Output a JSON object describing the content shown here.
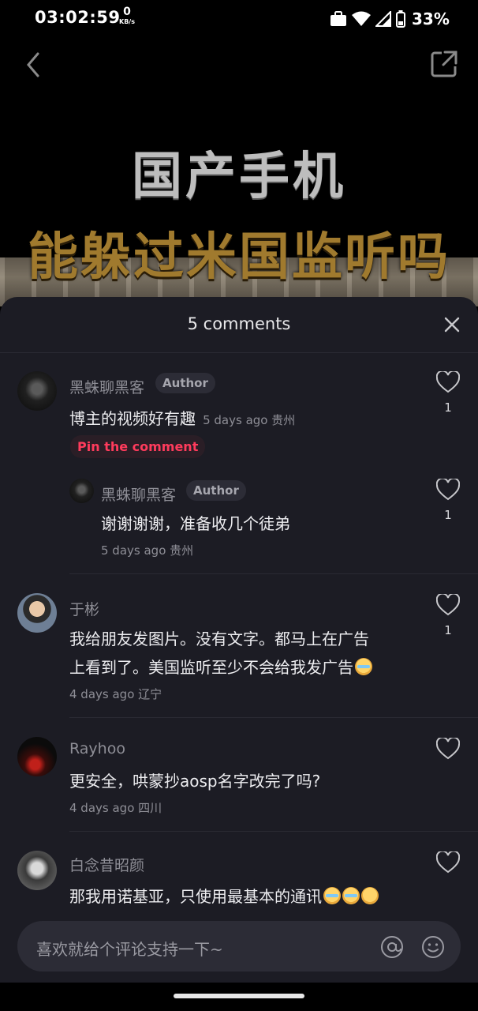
{
  "status_bar": {
    "time": "03:02:59",
    "net_speed": "0",
    "net_unit": "KB/s",
    "battery": "33%"
  },
  "video": {
    "title_line1": "国产手机",
    "title_line2": "能躲过米国监听吗"
  },
  "comments_sheet": {
    "title": "5 comments",
    "pin_label": "Pin the comment",
    "comments": [
      {
        "user": "黑蛛聊黑客",
        "badge": "Author",
        "text": "博主的视频好有趣",
        "meta": "5 days ago 贵州",
        "likes": "1"
      },
      {
        "user": "黑蛛聊黑客",
        "badge": "Author",
        "text": "谢谢谢谢，准备收几个徒弟",
        "meta": "5 days ago 贵州",
        "likes": "1"
      },
      {
        "user": "于彬",
        "text_line1": "我给朋友发图片。没有文字。都马上在广告",
        "text_line2": "上看到了。美国监听至少不会给我发广告",
        "meta": "4 days ago 辽宁",
        "likes": "1"
      },
      {
        "user": "Rayhoo",
        "text": "更安全，哄蒙抄aosp名字改完了吗?",
        "meta": "4 days ago 四川"
      },
      {
        "user": "白念昔昭颜",
        "text": "那我用诺基亚，只使用最基本的通讯"
      }
    ]
  },
  "input": {
    "placeholder": "喜欢就给个评论支持一下~"
  },
  "icons": [
    "back-icon",
    "share-icon",
    "close-icon",
    "heart-icon",
    "at-icon",
    "emoji-icon"
  ]
}
